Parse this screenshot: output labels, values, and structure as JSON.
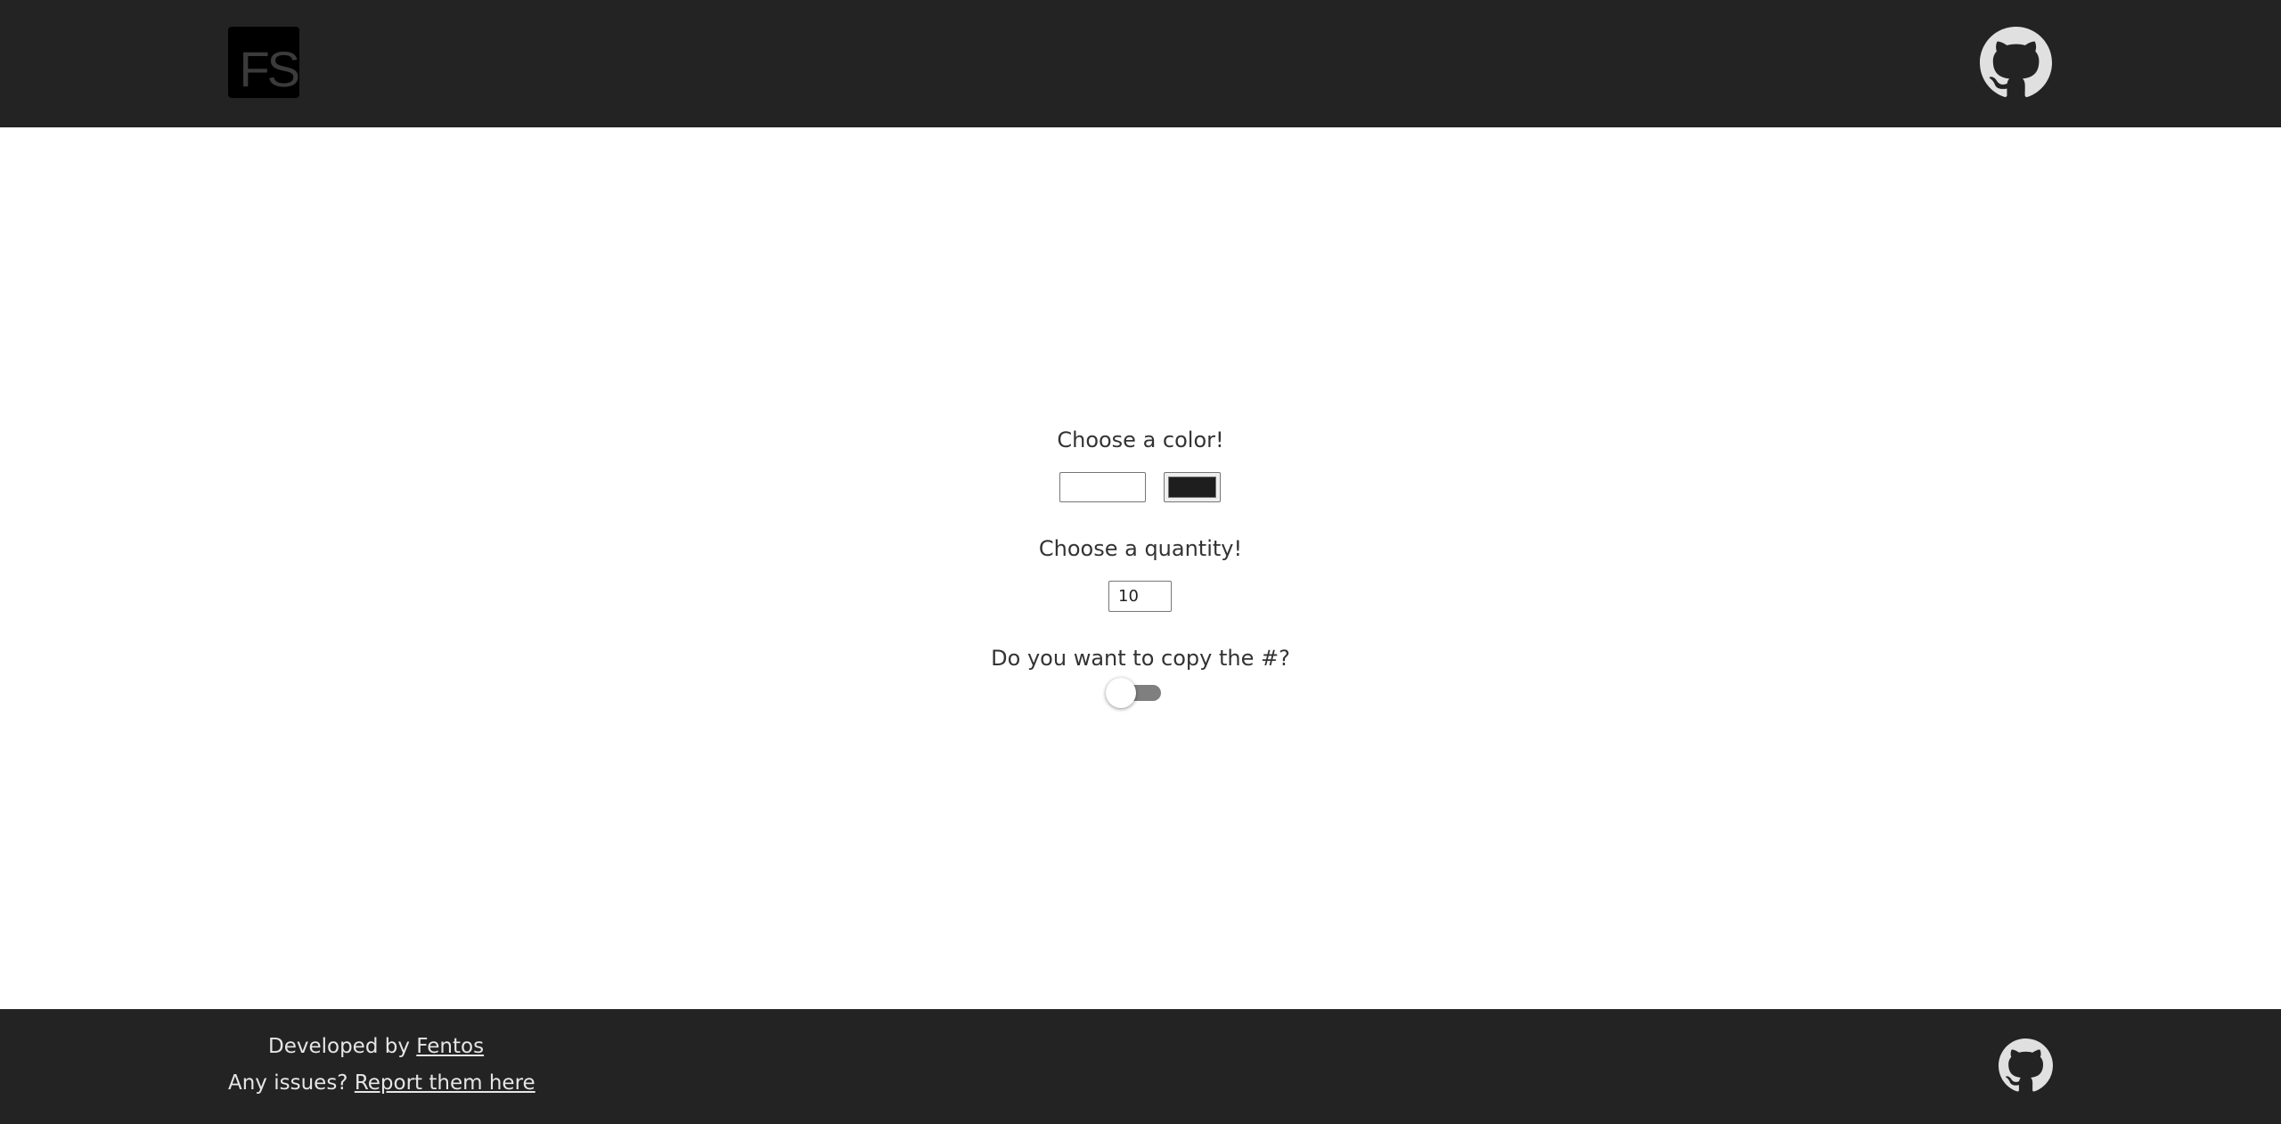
{
  "header": {
    "logo_text": "FS",
    "github_icon": "github-icon"
  },
  "form": {
    "color_label": "Choose a color!",
    "color_text_value": "",
    "color_swatch_value": "#1e1e1e",
    "quantity_label": "Choose a quantity!",
    "quantity_value": "10",
    "copy_label": "Do you want to copy the #?",
    "copy_toggle_on": false
  },
  "footer": {
    "developed_by_prefix": "Developed by",
    "developer_link": "Fentos",
    "issues_prefix": "Any issues?",
    "issues_link": "Report them here",
    "github_icon": "github-icon"
  },
  "colors": {
    "header_bg": "#232323",
    "footer_bg": "#232323",
    "toggle_track": "#7f7f7f",
    "icon_gray": "#e0e0e0"
  }
}
